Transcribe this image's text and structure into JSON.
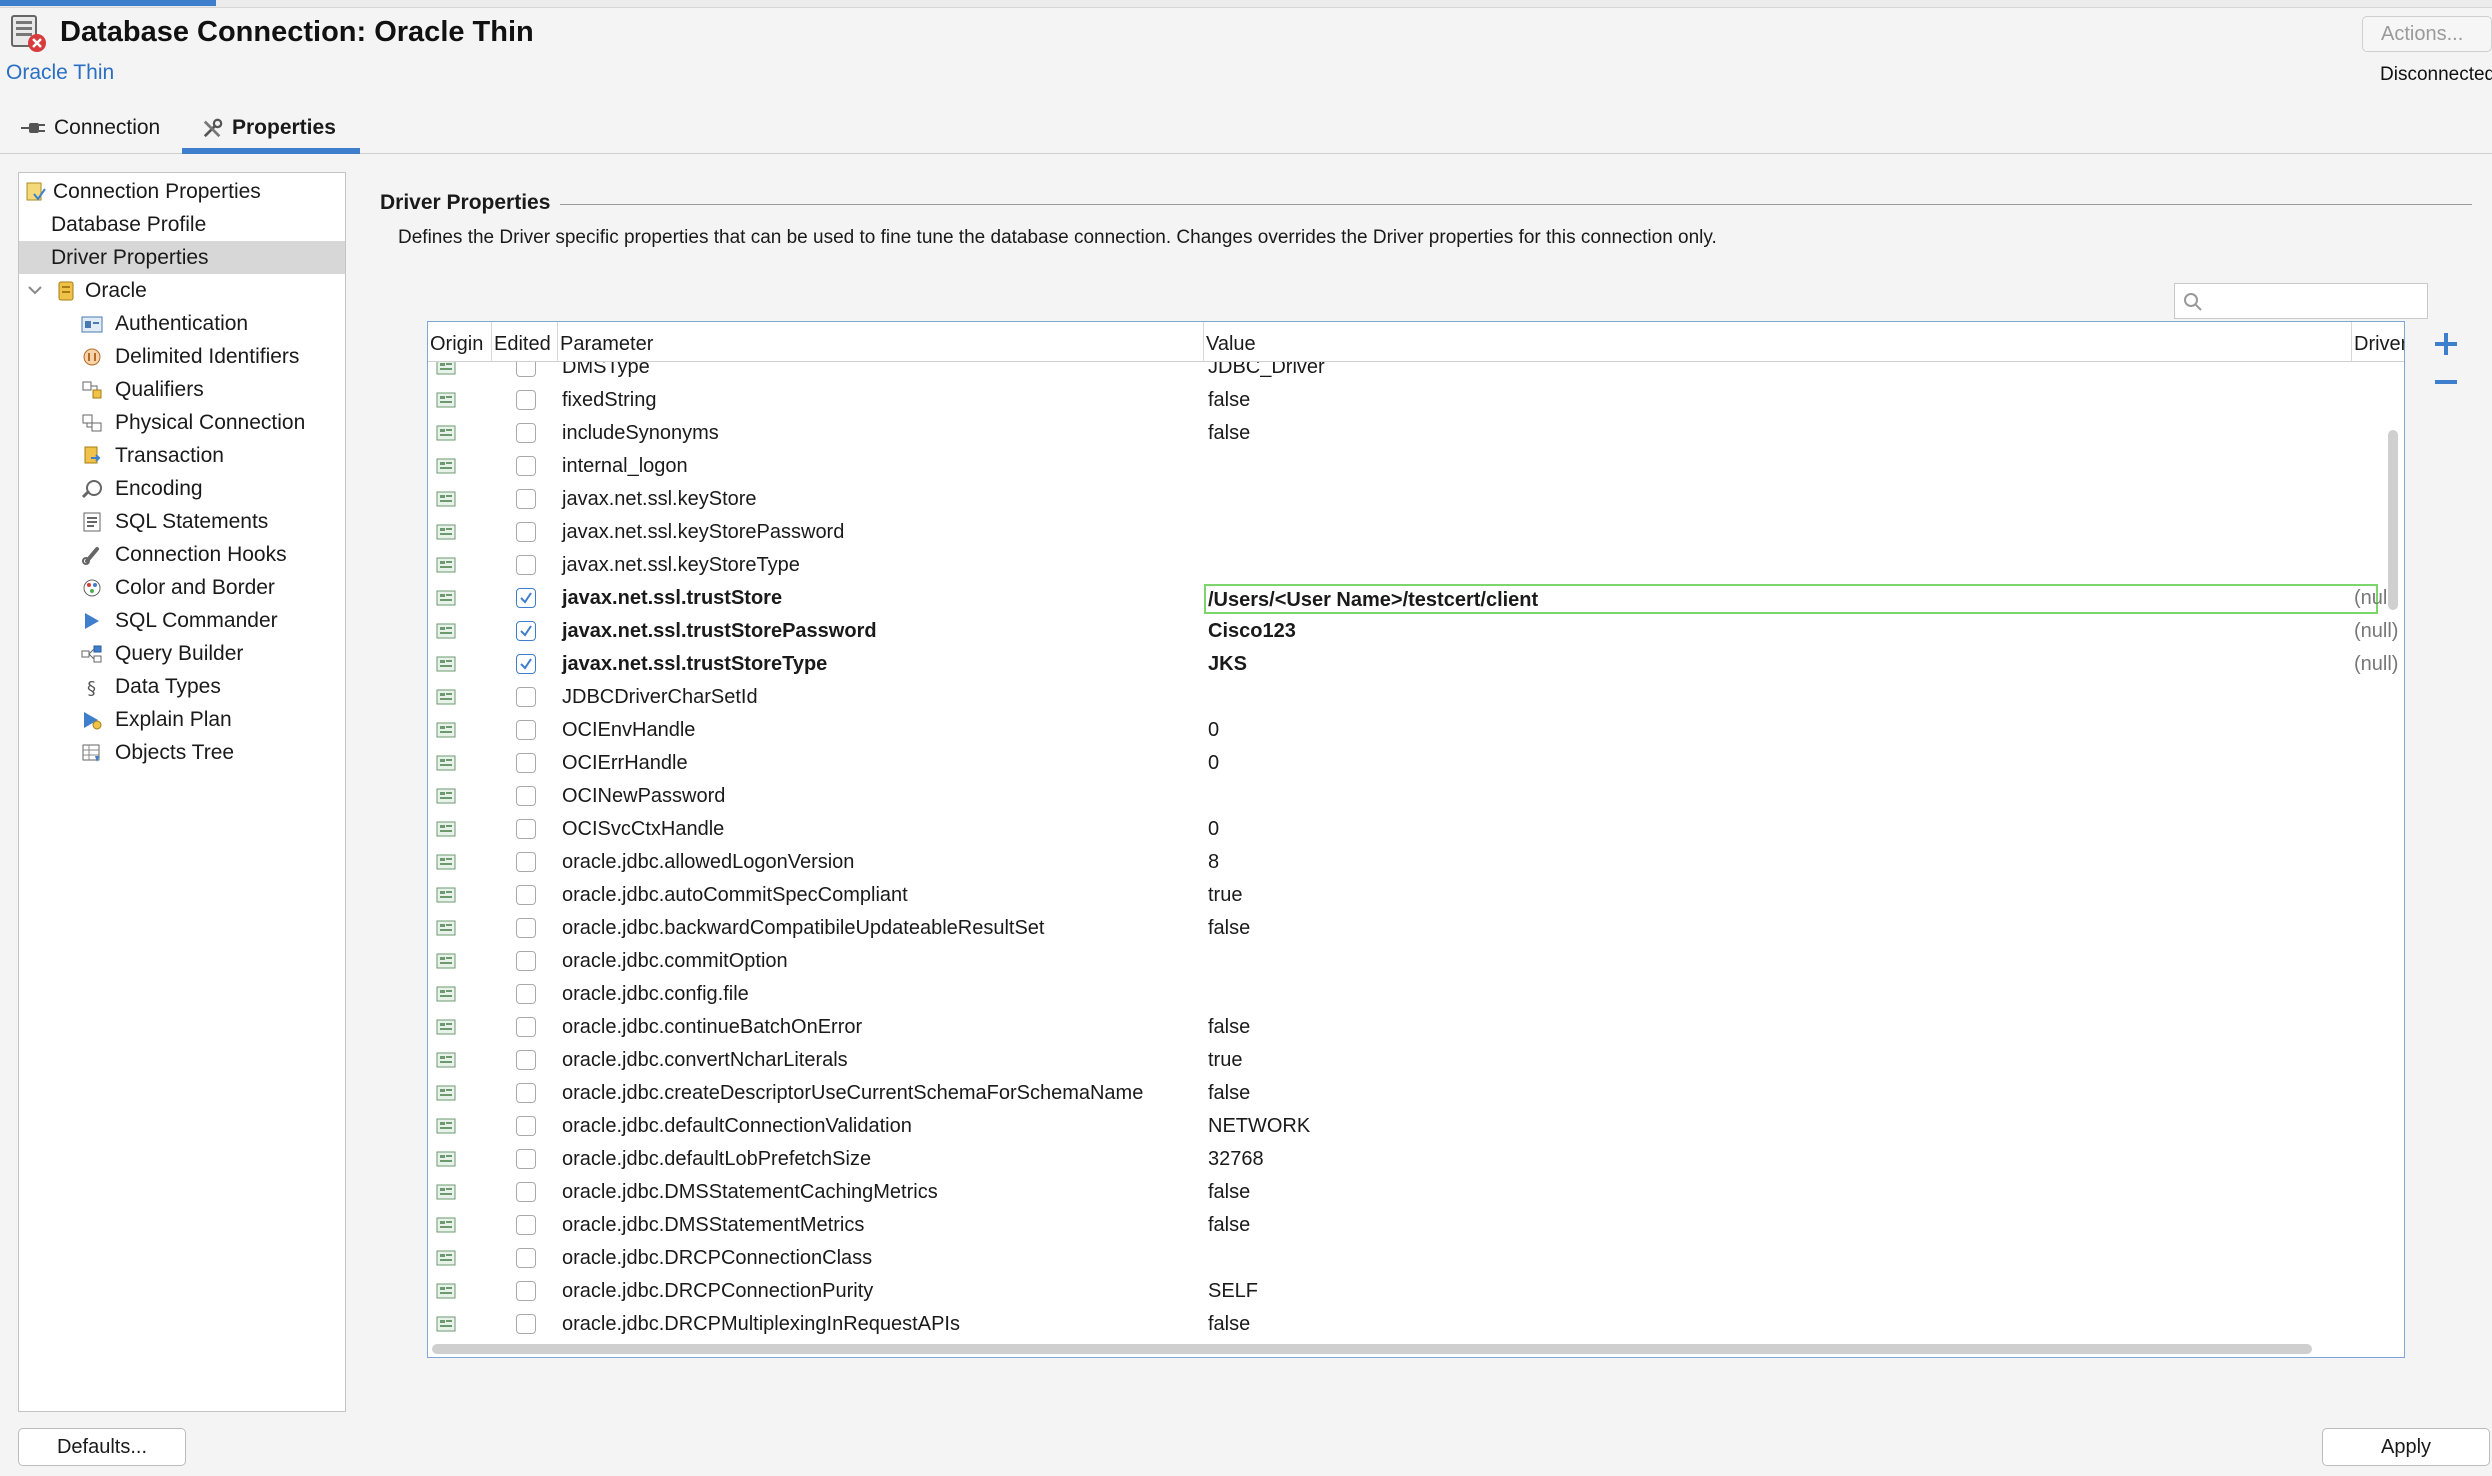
{
  "window": {
    "title": "Database Connection: Oracle Thin",
    "subtitle": "Oracle Thin",
    "actions_label": "Actions...",
    "status_label": "Disconnected",
    "accent_color": "#3d7fcc"
  },
  "tabs": [
    {
      "label": "Connection",
      "icon": "plug-icon",
      "selected": false
    },
    {
      "label": "Properties",
      "icon": "tools-icon",
      "selected": true
    }
  ],
  "sidebar": {
    "items": [
      {
        "label": "Connection Properties",
        "icon": "connection-properties-icon",
        "level": 0
      },
      {
        "label": "Database Profile",
        "icon": "",
        "level": 1
      },
      {
        "label": "Driver Properties",
        "icon": "",
        "level": 1,
        "selected": true
      },
      {
        "label": "Oracle",
        "icon": "oracle-database-icon",
        "level": 0,
        "expanded": true
      },
      {
        "label": "Authentication",
        "icon": "authentication-icon",
        "level": 2
      },
      {
        "label": "Delimited Identifiers",
        "icon": "delimited-identifiers-icon",
        "level": 2
      },
      {
        "label": "Qualifiers",
        "icon": "qualifiers-icon",
        "level": 2
      },
      {
        "label": "Physical Connection",
        "icon": "physical-connection-icon",
        "level": 2
      },
      {
        "label": "Transaction",
        "icon": "transaction-icon",
        "level": 2
      },
      {
        "label": "Encoding",
        "icon": "encoding-icon",
        "level": 2
      },
      {
        "label": "SQL Statements",
        "icon": "sql-statements-icon",
        "level": 2
      },
      {
        "label": "Connection Hooks",
        "icon": "connection-hooks-icon",
        "level": 2
      },
      {
        "label": "Color and Border",
        "icon": "color-border-icon",
        "level": 2
      },
      {
        "label": "SQL Commander",
        "icon": "sql-commander-icon",
        "level": 2
      },
      {
        "label": "Query Builder",
        "icon": "query-builder-icon",
        "level": 2
      },
      {
        "label": "Data Types",
        "icon": "data-types-icon",
        "level": 2
      },
      {
        "label": "Explain Plan",
        "icon": "explain-plan-icon",
        "level": 2
      },
      {
        "label": "Objects Tree",
        "icon": "objects-tree-icon",
        "level": 2
      }
    ]
  },
  "main": {
    "section_title": "Driver Properties",
    "description": "Defines the Driver specific properties that can be used to fine tune the database connection. Changes overrides the Driver properties for this connection only.",
    "search_placeholder": "",
    "table": {
      "columns": [
        "Origin",
        "Edited",
        "Parameter",
        "Value",
        "Driver"
      ],
      "rows": [
        {
          "param": "DMSType",
          "value": "JDBC_Driver",
          "edited": false,
          "driver": ""
        },
        {
          "param": "fixedString",
          "value": "false",
          "edited": false,
          "driver": ""
        },
        {
          "param": "includeSynonyms",
          "value": "false",
          "edited": false,
          "driver": ""
        },
        {
          "param": "internal_logon",
          "value": "",
          "edited": false,
          "driver": ""
        },
        {
          "param": "javax.net.ssl.keyStore",
          "value": "",
          "edited": false,
          "driver": ""
        },
        {
          "param": "javax.net.ssl.keyStorePassword",
          "value": "",
          "edited": false,
          "driver": ""
        },
        {
          "param": "javax.net.ssl.keyStoreType",
          "value": "",
          "edited": false,
          "driver": ""
        },
        {
          "param": "javax.net.ssl.trustStore",
          "value": "/Users/<User Name>/testcert/client",
          "edited": true,
          "editing": true,
          "driver": "(null)"
        },
        {
          "param": "javax.net.ssl.trustStorePassword",
          "value": "Cisco123",
          "edited": true,
          "driver": "(null)"
        },
        {
          "param": "javax.net.ssl.trustStoreType",
          "value": "JKS",
          "edited": true,
          "driver": "(null)"
        },
        {
          "param": "JDBCDriverCharSetId",
          "value": "",
          "edited": false,
          "driver": ""
        },
        {
          "param": "OCIEnvHandle",
          "value": "0",
          "edited": false,
          "driver": ""
        },
        {
          "param": "OCIErrHandle",
          "value": "0",
          "edited": false,
          "driver": ""
        },
        {
          "param": "OCINewPassword",
          "value": "",
          "edited": false,
          "driver": ""
        },
        {
          "param": "OCISvcCtxHandle",
          "value": "0",
          "edited": false,
          "driver": ""
        },
        {
          "param": "oracle.jdbc.allowedLogonVersion",
          "value": "8",
          "edited": false,
          "driver": ""
        },
        {
          "param": "oracle.jdbc.autoCommitSpecCompliant",
          "value": "true",
          "edited": false,
          "driver": ""
        },
        {
          "param": "oracle.jdbc.backwardCompatibileUpdateableResultSet",
          "value": "false",
          "edited": false,
          "driver": ""
        },
        {
          "param": "oracle.jdbc.commitOption",
          "value": "",
          "edited": false,
          "driver": ""
        },
        {
          "param": "oracle.jdbc.config.file",
          "value": "",
          "edited": false,
          "driver": ""
        },
        {
          "param": "oracle.jdbc.continueBatchOnError",
          "value": "false",
          "edited": false,
          "driver": ""
        },
        {
          "param": "oracle.jdbc.convertNcharLiterals",
          "value": "true",
          "edited": false,
          "driver": ""
        },
        {
          "param": "oracle.jdbc.createDescriptorUseCurrentSchemaForSchemaName",
          "value": "false",
          "edited": false,
          "driver": ""
        },
        {
          "param": "oracle.jdbc.defaultConnectionValidation",
          "value": "NETWORK",
          "edited": false,
          "driver": ""
        },
        {
          "param": "oracle.jdbc.defaultLobPrefetchSize",
          "value": "32768",
          "edited": false,
          "driver": ""
        },
        {
          "param": "oracle.jdbc.DMSStatementCachingMetrics",
          "value": "false",
          "edited": false,
          "driver": ""
        },
        {
          "param": "oracle.jdbc.DMSStatementMetrics",
          "value": "false",
          "edited": false,
          "driver": ""
        },
        {
          "param": "oracle.jdbc.DRCPConnectionClass",
          "value": "",
          "edited": false,
          "driver": ""
        },
        {
          "param": "oracle.jdbc.DRCPConnectionPurity",
          "value": "SELF",
          "edited": false,
          "driver": ""
        },
        {
          "param": "oracle.jdbc.DRCPMultiplexingInRequestAPIs",
          "value": "false",
          "edited": false,
          "driver": ""
        }
      ]
    }
  },
  "footer": {
    "defaults_label": "Defaults...",
    "apply_label": "Apply"
  }
}
